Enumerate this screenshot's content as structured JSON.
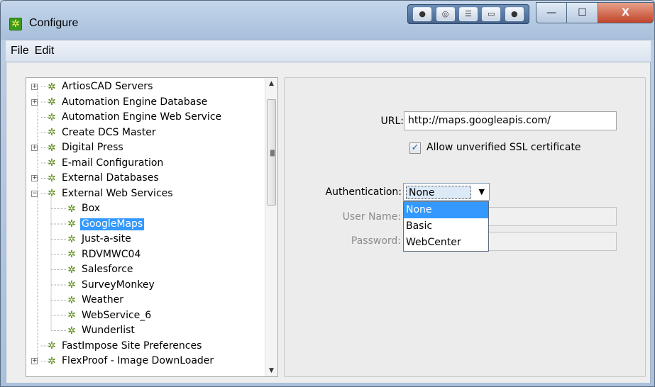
{
  "window": {
    "title": "Configure",
    "toolbar_tools": [
      "camera-icon",
      "settings-tool-icon",
      "layout-icon",
      "window-icon",
      "record-icon"
    ],
    "controls": {
      "minimize": "—",
      "maximize": "☐",
      "close": "X"
    }
  },
  "menu": [
    {
      "label": "File"
    },
    {
      "label": "Edit"
    }
  ],
  "tree": {
    "items": [
      {
        "label": "ArtiosCAD Servers",
        "level": 0,
        "expander": "+"
      },
      {
        "label": "Automation Engine Database",
        "level": 0,
        "expander": "+"
      },
      {
        "label": "Automation Engine Web Service",
        "level": 0,
        "expander": ""
      },
      {
        "label": "Create DCS Master",
        "level": 0,
        "expander": ""
      },
      {
        "label": "Digital Press",
        "level": 0,
        "expander": "+"
      },
      {
        "label": "E-mail Configuration",
        "level": 0,
        "expander": ""
      },
      {
        "label": "External Databases",
        "level": 0,
        "expander": "+"
      },
      {
        "label": "External Web Services",
        "level": 0,
        "expander": "−"
      },
      {
        "label": "Box",
        "level": 1,
        "expander": ""
      },
      {
        "label": "GoogleMaps",
        "level": 1,
        "expander": "",
        "selected": true
      },
      {
        "label": "Just-a-site",
        "level": 1,
        "expander": ""
      },
      {
        "label": "RDVMWC04",
        "level": 1,
        "expander": ""
      },
      {
        "label": "Salesforce",
        "level": 1,
        "expander": ""
      },
      {
        "label": "SurveyMonkey",
        "level": 1,
        "expander": ""
      },
      {
        "label": "Weather",
        "level": 1,
        "expander": ""
      },
      {
        "label": "WebService_6",
        "level": 1,
        "expander": ""
      },
      {
        "label": "Wunderlist",
        "level": 1,
        "expander": ""
      },
      {
        "label": "FastImpose Site Preferences",
        "level": 0,
        "expander": ""
      },
      {
        "label": "FlexProof - Image DownLoader",
        "level": 0,
        "expander": "+"
      }
    ]
  },
  "form": {
    "url_label": "URL:",
    "url_value": "http://maps.googleapis.com/",
    "ssl_checked": true,
    "ssl_label": "Allow unverified SSL certificate",
    "auth_label": "Authentication:",
    "auth_selected": "None",
    "auth_options": [
      "None",
      "Basic",
      "WebCenter"
    ],
    "username_label": "User Name:",
    "username_value": "",
    "password_label": "Password:",
    "password_value": ""
  },
  "colors": {
    "selection": "#3399ff",
    "tree_icon": "#5a8a14"
  }
}
